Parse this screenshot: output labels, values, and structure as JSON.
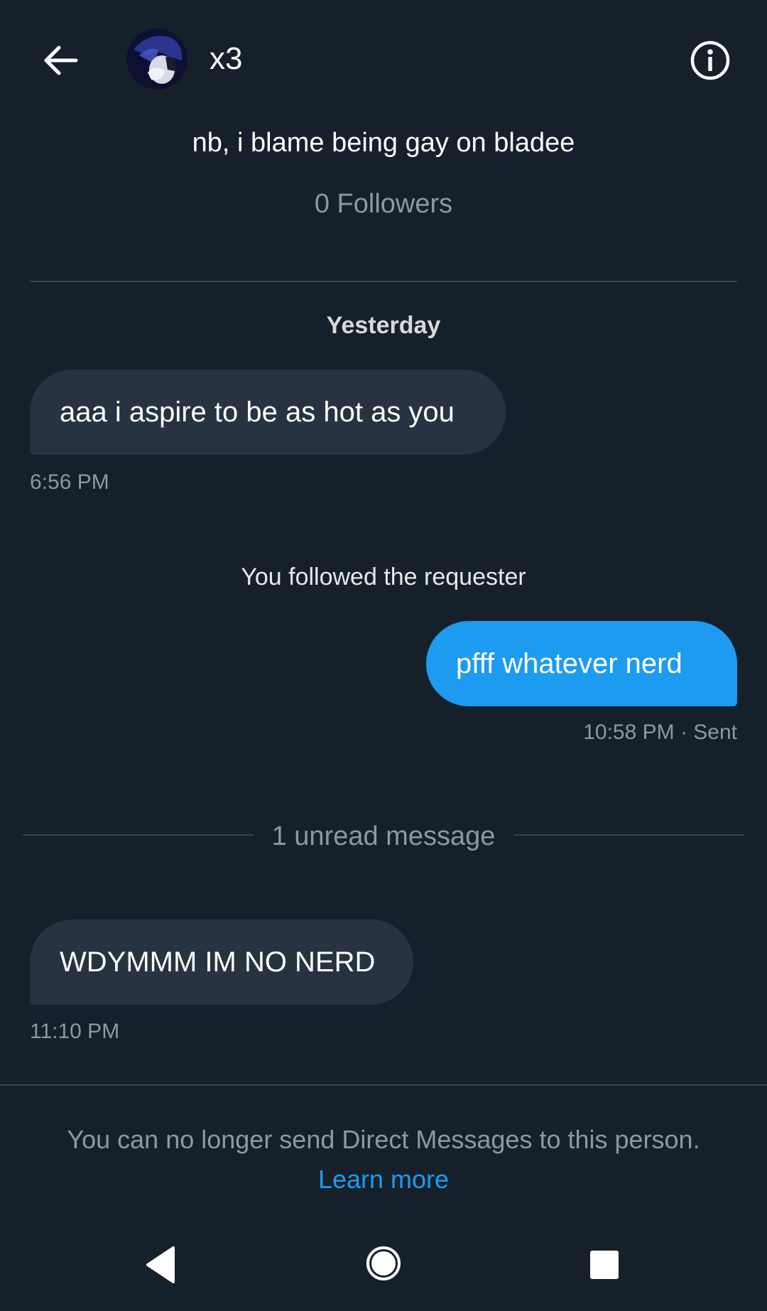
{
  "header": {
    "title": "x3",
    "back_icon": "arrow-left-icon",
    "info_icon": "info-icon"
  },
  "profile": {
    "bio": "nb, i blame being gay on bladee",
    "followers": "0 Followers"
  },
  "conversation": {
    "date_separator": "Yesterday",
    "messages": [
      {
        "direction": "incoming",
        "text": "aaa i aspire to be as hot as you",
        "time": "6:56 PM"
      },
      {
        "direction": "outgoing",
        "text": "pfff whatever nerd",
        "time": "10:58 PM · Sent"
      },
      {
        "direction": "incoming",
        "text": "WDYMMM IM NO NERD",
        "time": "11:10 PM"
      }
    ],
    "system_note": "You followed the requester",
    "unread_label": "1 unread message"
  },
  "footer": {
    "notice": "You can no longer send Direct Messages to this person.",
    "learn_more": "Learn more"
  },
  "colors": {
    "background": "#15202b",
    "incoming_bubble": "#273340",
    "outgoing_bubble": "#1d9bf0",
    "link": "#1d9bf0",
    "muted_text": "#8b98a5"
  }
}
